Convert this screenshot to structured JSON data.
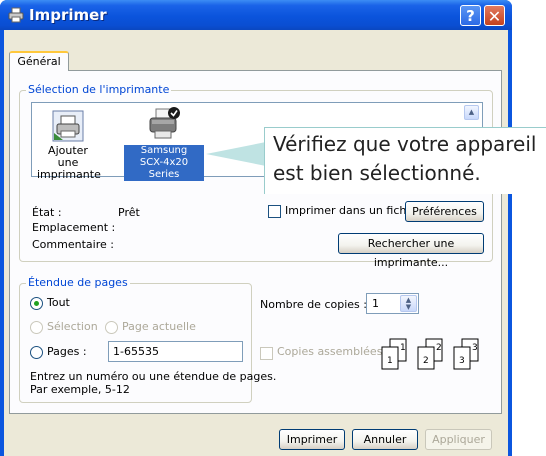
{
  "window": {
    "title": "Imprimer",
    "help_label": "?",
    "close_label": "✕"
  },
  "tabs": [
    {
      "label": "Général"
    }
  ],
  "printer_selection": {
    "title": "Sélection de l'imprimante",
    "printers": [
      {
        "label_line1": "Ajouter une",
        "label_line2": "imprimante"
      },
      {
        "label_line1": "Samsung",
        "label_line2": "SCX-4x20 Series",
        "selected": true
      }
    ],
    "status_label": "État :",
    "status_value": "Prêt",
    "location_label": "Emplacement :",
    "comment_label": "Commentaire :",
    "print_to_file_label": "Imprimer dans un fichier",
    "preferences_button": "Préférences",
    "find_printer_button": "Rechercher une imprimante..."
  },
  "callout": {
    "line1": "Vérifiez que votre appareil",
    "line2": "est bien sélectionné."
  },
  "page_range": {
    "title": "Étendue de pages",
    "all_label": "Tout",
    "selection_label": "Sélection",
    "current_page_label": "Page actuelle",
    "pages_label": "Pages :",
    "pages_value": "1-65535",
    "help_line1": "Entrez un numéro ou une étendue de pages.",
    "help_line2": "Par exemple, 5-12",
    "selected": "all"
  },
  "copies": {
    "label": "Nombre de copies :",
    "value": "1",
    "collate_label": "Copies assemblées",
    "collate_checked": false,
    "illustration_numbers": [
      "1",
      "1",
      "2",
      "2",
      "3",
      "3"
    ]
  },
  "buttons": {
    "print": "Imprimer",
    "cancel": "Annuler",
    "apply": "Appliquer"
  },
  "colors": {
    "titlebar": "#0b54dc",
    "selection": "#316ac5",
    "group_title": "#0046d5",
    "radio_dot": "#21a121"
  }
}
